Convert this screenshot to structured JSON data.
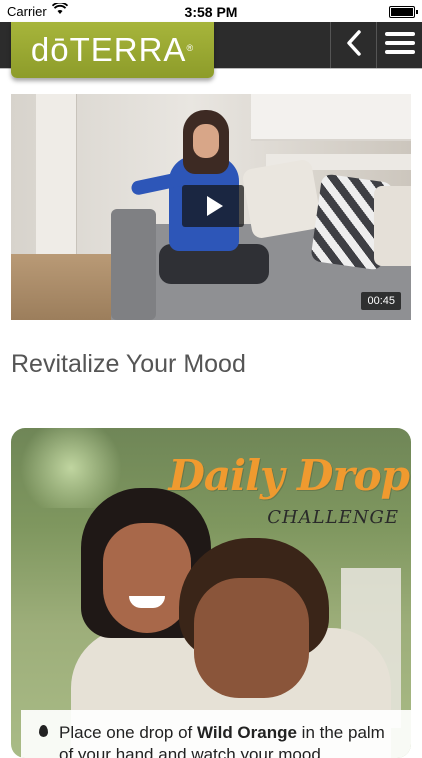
{
  "status_bar": {
    "carrier": "Carrier",
    "time": "3:58 PM"
  },
  "header": {
    "brand": "dōTERRA",
    "registered": "®",
    "back_icon": "chevron-left-icon",
    "menu_icon": "hamburger-menu-icon"
  },
  "video": {
    "duration": "00:45",
    "play_icon": "play-icon"
  },
  "section": {
    "title": "Revitalize Your Mood"
  },
  "card": {
    "heading": "Daily Drop",
    "subheading": "CHALLENGE",
    "tip_prefix": "Place one drop of ",
    "tip_bold": "Wild Orange",
    "tip_suffix": " in the palm of your hand and watch your mood"
  },
  "colors": {
    "brand_green": "#9aa832",
    "nav_bg": "#2c2c2c",
    "accent_orange": "#f09a2f"
  }
}
